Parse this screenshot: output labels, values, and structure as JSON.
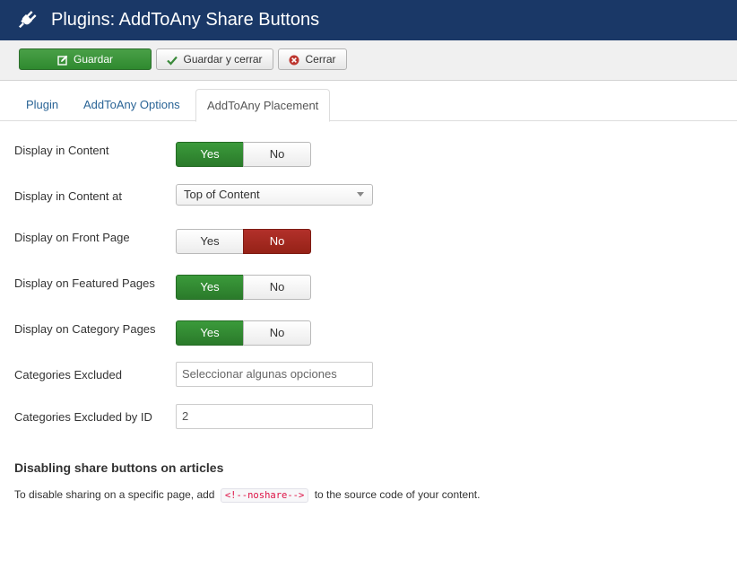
{
  "header": {
    "title": "Plugins: AddToAny Share Buttons",
    "icon": "plug-icon",
    "background": "#1a3867"
  },
  "toolbar": {
    "save_label": "Guardar",
    "save_close_label": "Guardar y cerrar",
    "close_label": "Cerrar"
  },
  "tabs": [
    {
      "label": "Plugin",
      "active": false
    },
    {
      "label": "AddToAny Options",
      "active": false
    },
    {
      "label": "AddToAny Placement",
      "active": true
    }
  ],
  "fields": {
    "display_in_content": {
      "label": "Display in Content",
      "yes": "Yes",
      "no": "No",
      "value": "Yes"
    },
    "display_in_content_at": {
      "label": "Display in Content at",
      "value": "Top of Content"
    },
    "display_on_front_page": {
      "label": "Display on Front Page",
      "yes": "Yes",
      "no": "No",
      "value": "No"
    },
    "display_on_featured_pages": {
      "label": "Display on Featured Pages",
      "yes": "Yes",
      "no": "No",
      "value": "Yes"
    },
    "display_on_category_pages": {
      "label": "Display on Category Pages",
      "yes": "Yes",
      "no": "No",
      "value": "Yes"
    },
    "categories_excluded": {
      "label": "Categories Excluded",
      "placeholder": "Seleccionar algunas opciones"
    },
    "categories_excluded_by_id": {
      "label": "Categories Excluded by ID",
      "value": "2"
    }
  },
  "disable_section": {
    "title": "Disabling share buttons on articles",
    "text_before": "To disable sharing on a specific page, add",
    "code": "<!--noshare-->",
    "text_after": "to the source code of your content."
  },
  "colors": {
    "yes_active": "#2f8a2f",
    "no_active": "#a0281f",
    "link": "#2a6496"
  }
}
